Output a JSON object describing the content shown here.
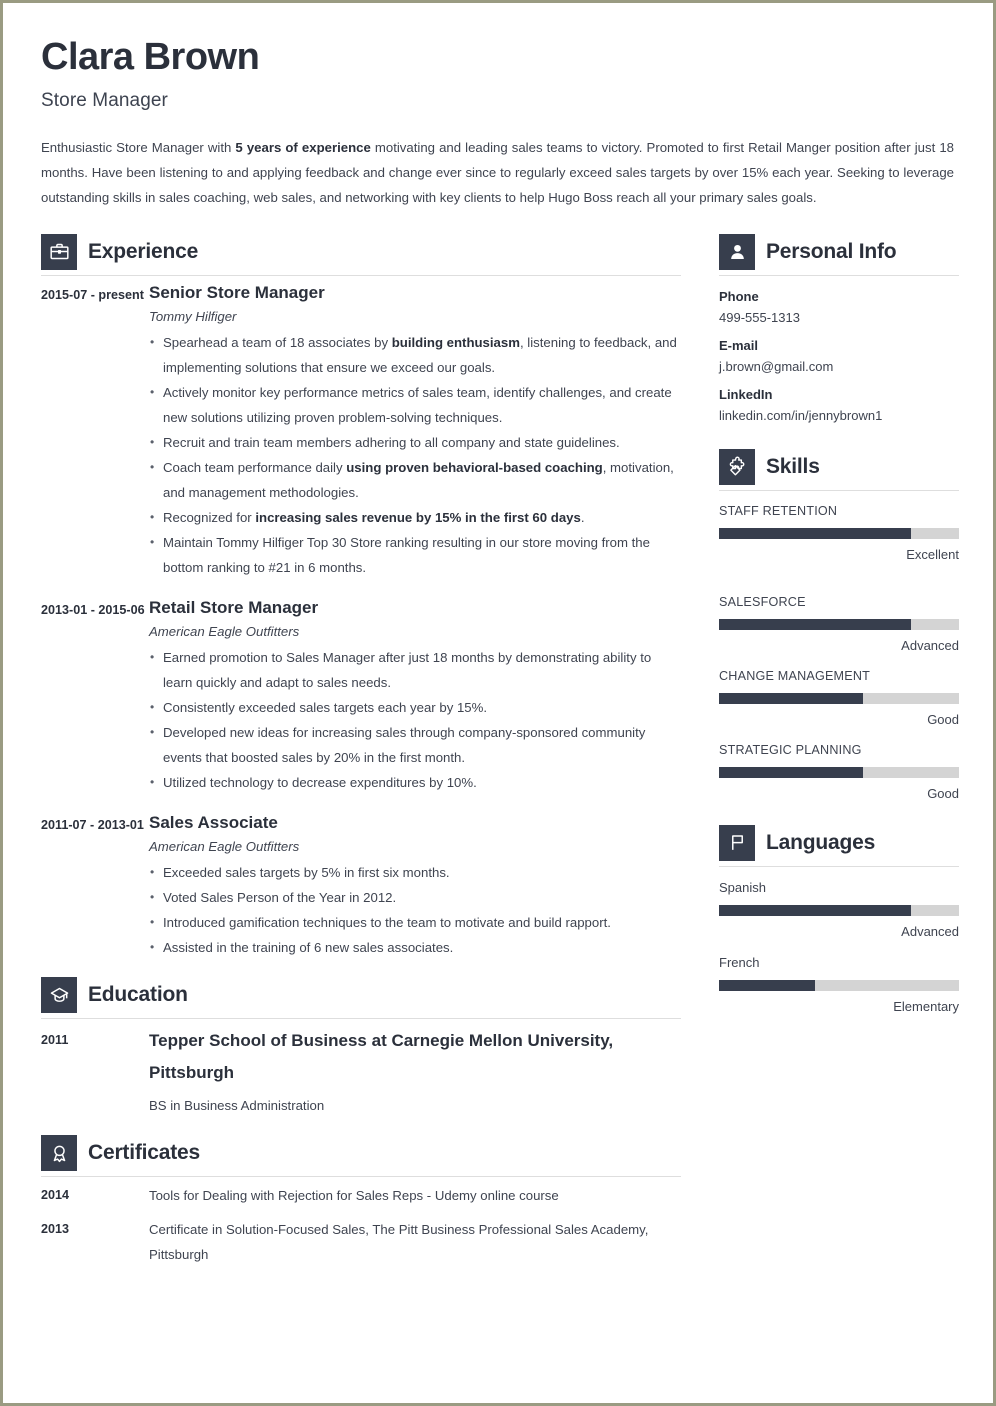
{
  "theme": {
    "dark": "#373e4d",
    "track": "#d4d4d4",
    "text": "#3f4450",
    "heading": "#2b303b",
    "page_border": "#9a9b82"
  },
  "header": {
    "name": "Clara Brown",
    "job_title": "Store Manager",
    "summary_parts": [
      {
        "text": "Enthusiastic Store Manager with ",
        "bold": false
      },
      {
        "text": "5 years of experience",
        "bold": true
      },
      {
        "text": " motivating and leading sales teams to victory. Promoted to first Retail Manger position after just 18 months. Have been listening to and applying feedback and change ever since to regularly exceed sales targets by over 15% each year. Seeking to leverage outstanding skills in sales coaching, web sales, and networking with key clients to help Hugo Boss reach all your primary sales goals.",
        "bold": false
      }
    ]
  },
  "experience": {
    "title": "Experience",
    "icon": "briefcase-icon",
    "entries": [
      {
        "date": "2015-07 - present",
        "title": "Senior Store Manager",
        "company": "Tommy Hilfiger",
        "bullets": [
          [
            {
              "text": "Spearhead a team of 18 associates by ",
              "bold": false
            },
            {
              "text": "building enthusiasm",
              "bold": true
            },
            {
              "text": ", listening to feedback, and implementing solutions that ensure we exceed our goals.",
              "bold": false
            }
          ],
          [
            {
              "text": "Actively monitor key performance metrics of sales team, identify challenges, and create new solutions utilizing proven problem-solving techniques.",
              "bold": false
            }
          ],
          [
            {
              "text": "Recruit and train team members adhering to all company and state guidelines.",
              "bold": false
            }
          ],
          [
            {
              "text": "Coach team performance daily ",
              "bold": false
            },
            {
              "text": "using proven behavioral-based coaching",
              "bold": true
            },
            {
              "text": ", motivation, and management methodologies.",
              "bold": false
            }
          ],
          [
            {
              "text": "Recognized for ",
              "bold": false
            },
            {
              "text": "increasing sales revenue by 15% in the first 60 days",
              "bold": true
            },
            {
              "text": ".",
              "bold": false
            }
          ],
          [
            {
              "text": "Maintain Tommy Hilfiger Top 30 Store ranking resulting in our store moving from the bottom ranking to #21 in 6 months.",
              "bold": false
            }
          ]
        ]
      },
      {
        "date": "2013-01 - 2015-06",
        "title": "Retail Store Manager",
        "company": "American Eagle Outfitters",
        "bullets": [
          [
            {
              "text": "Earned promotion to Sales Manager after just 18 months by demonstrating ability to learn quickly and adapt to sales needs.",
              "bold": false
            }
          ],
          [
            {
              "text": "Consistently exceeded sales targets each year by 15%.",
              "bold": false
            }
          ],
          [
            {
              "text": "Developed new ideas for increasing sales through company-sponsored community events that boosted sales by 20% in the first month.",
              "bold": false
            }
          ],
          [
            {
              "text": "Utilized technology to decrease expenditures by 10%.",
              "bold": false
            }
          ]
        ]
      },
      {
        "date": "2011-07 - 2013-01",
        "title": "Sales Associate",
        "company": "American Eagle Outfitters",
        "bullets": [
          [
            {
              "text": "Exceeded sales targets by 5% in first six months.",
              "bold": false
            }
          ],
          [
            {
              "text": "Voted Sales Person of the Year in 2012.",
              "bold": false
            }
          ],
          [
            {
              "text": "Introduced gamification techniques to the team to motivate and build rapport.",
              "bold": false
            }
          ],
          [
            {
              "text": "Assisted in the training of 6 new sales associates.",
              "bold": false
            }
          ]
        ]
      }
    ]
  },
  "education": {
    "title": "Education",
    "icon": "graduation-cap-icon",
    "entries": [
      {
        "date": "2011",
        "school": "Tepper School of Business at Carnegie Mellon University, Pittsburgh",
        "degree": "BS in Business Administration"
      }
    ]
  },
  "certificates": {
    "title": "Certificates",
    "icon": "award-ribbon-icon",
    "entries": [
      {
        "date": "2014",
        "text": "Tools for Dealing with Rejection for Sales Reps - Udemy online course"
      },
      {
        "date": "2013",
        "text": "Certificate in Solution-Focused Sales, The Pitt Business Professional Sales Academy, Pittsburgh"
      }
    ]
  },
  "personal_info": {
    "title": "Personal Info",
    "icon": "person-icon",
    "fields": [
      {
        "label": "Phone",
        "value": "499-555-1313"
      },
      {
        "label": "E-mail",
        "value": "j.brown@gmail.com"
      },
      {
        "label": "LinkedIn",
        "value": "linkedin.com/in/jennybrown1"
      }
    ]
  },
  "skills": {
    "title": "Skills",
    "icon": "puzzle-piece-icon",
    "items": [
      {
        "name": "STAFF RETENTION",
        "level": "Excellent",
        "percent": 80
      },
      {
        "name": "SALESFORCE",
        "level": "Advanced",
        "percent": 80
      },
      {
        "name": "CHANGE MANAGEMENT",
        "level": "Good",
        "percent": 60
      },
      {
        "name": "STRATEGIC PLANNING",
        "level": "Good",
        "percent": 60
      }
    ]
  },
  "languages": {
    "title": "Languages",
    "icon": "flag-icon",
    "items": [
      {
        "name": "Spanish",
        "level": "Advanced",
        "percent": 80
      },
      {
        "name": "French",
        "level": "Elementary",
        "percent": 40
      }
    ]
  }
}
